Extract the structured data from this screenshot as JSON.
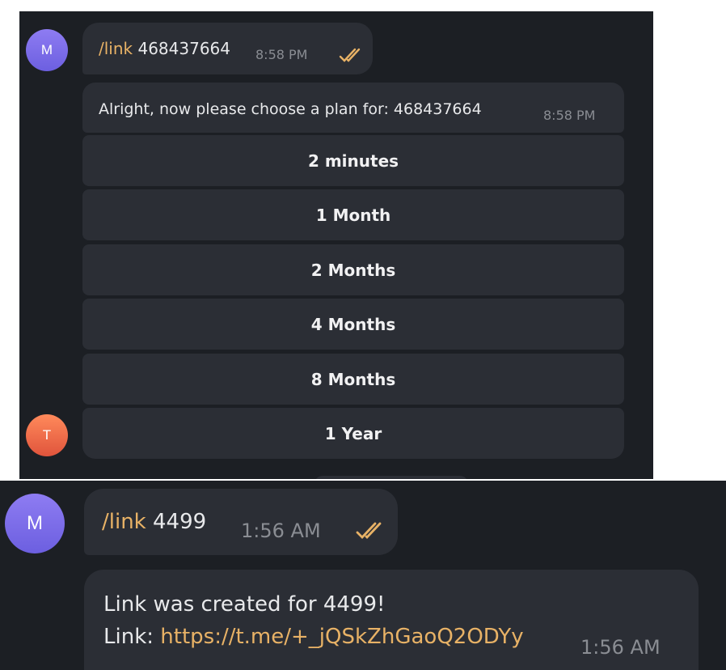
{
  "top": {
    "sent_message": {
      "avatar_letter": "M",
      "command": "/link",
      "argument": " 468437664",
      "time": "8:58 PM"
    },
    "bot_message": {
      "text": "Alright, now please choose a plan for: 468437664",
      "time": "8:58 PM",
      "avatar_letter": "T"
    },
    "plan_buttons": [
      "2 minutes",
      "1 Month",
      "2 Months",
      "4 Months",
      "8 Months",
      "1 Year"
    ]
  },
  "bottom": {
    "sent_message": {
      "avatar_letter": "M",
      "command": "/link",
      "argument": " 4499",
      "time": "1:56 AM"
    },
    "bot_message": {
      "line1": "Link was created for 4499!",
      "line2_prefix": "Link: ",
      "link_url": "https://t.me/+_jQSkZhGaoQ2ODYy",
      "time": "1:56 AM"
    }
  },
  "colors": {
    "background": "#1c1f24",
    "bubble": "#2b2e35",
    "accent": "#e8b266",
    "timestamp": "#8a8d93"
  },
  "icons": {
    "read_receipt": "double-check-icon"
  }
}
